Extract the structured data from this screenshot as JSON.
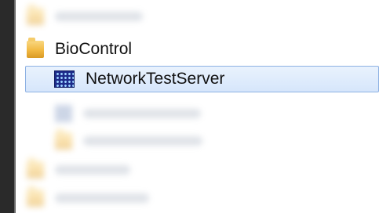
{
  "menu": {
    "items": [
      {
        "id": "blurred-top",
        "label": "",
        "icon": "folder-icon",
        "blurred": true
      },
      {
        "id": "biocontrol",
        "label": "BioControl",
        "icon": "folder-icon",
        "blurred": false
      },
      {
        "id": "networktestserver",
        "label": "NetworkTestServer",
        "icon": "grid-app-icon",
        "blurred": false,
        "selected": true
      },
      {
        "id": "blurred-1",
        "label": "",
        "icon": "app-icon",
        "blurred": true
      },
      {
        "id": "blurred-2",
        "label": "",
        "icon": "folder-icon",
        "blurred": true
      },
      {
        "id": "blurred-3",
        "label": "",
        "icon": "folder-icon",
        "blurred": true
      },
      {
        "id": "blurred-4",
        "label": "",
        "icon": "folder-icon",
        "blurred": true
      }
    ]
  },
  "colors": {
    "selection_fill": "#dbe8fb",
    "selection_border": "#8db1e3",
    "folder": "#f2b943",
    "grid_icon": "#1d2b8a"
  }
}
